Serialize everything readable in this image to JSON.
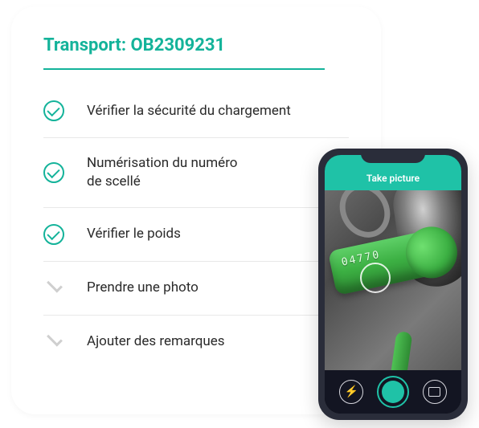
{
  "card": {
    "title": "Transport: OB2309231",
    "items": [
      {
        "label": "Vérifier la sécurité du chargement",
        "done": true
      },
      {
        "label": "Numérisation du numéro\nde scellé",
        "done": true
      },
      {
        "label": "Vérifier le poids",
        "done": true
      },
      {
        "label": "Prendre une photo",
        "done": false
      },
      {
        "label": "Ajouter des remarques",
        "done": false
      }
    ]
  },
  "phone": {
    "header_title": "Take picture",
    "seal_number": "04770",
    "flash_glyph": "⚡"
  }
}
